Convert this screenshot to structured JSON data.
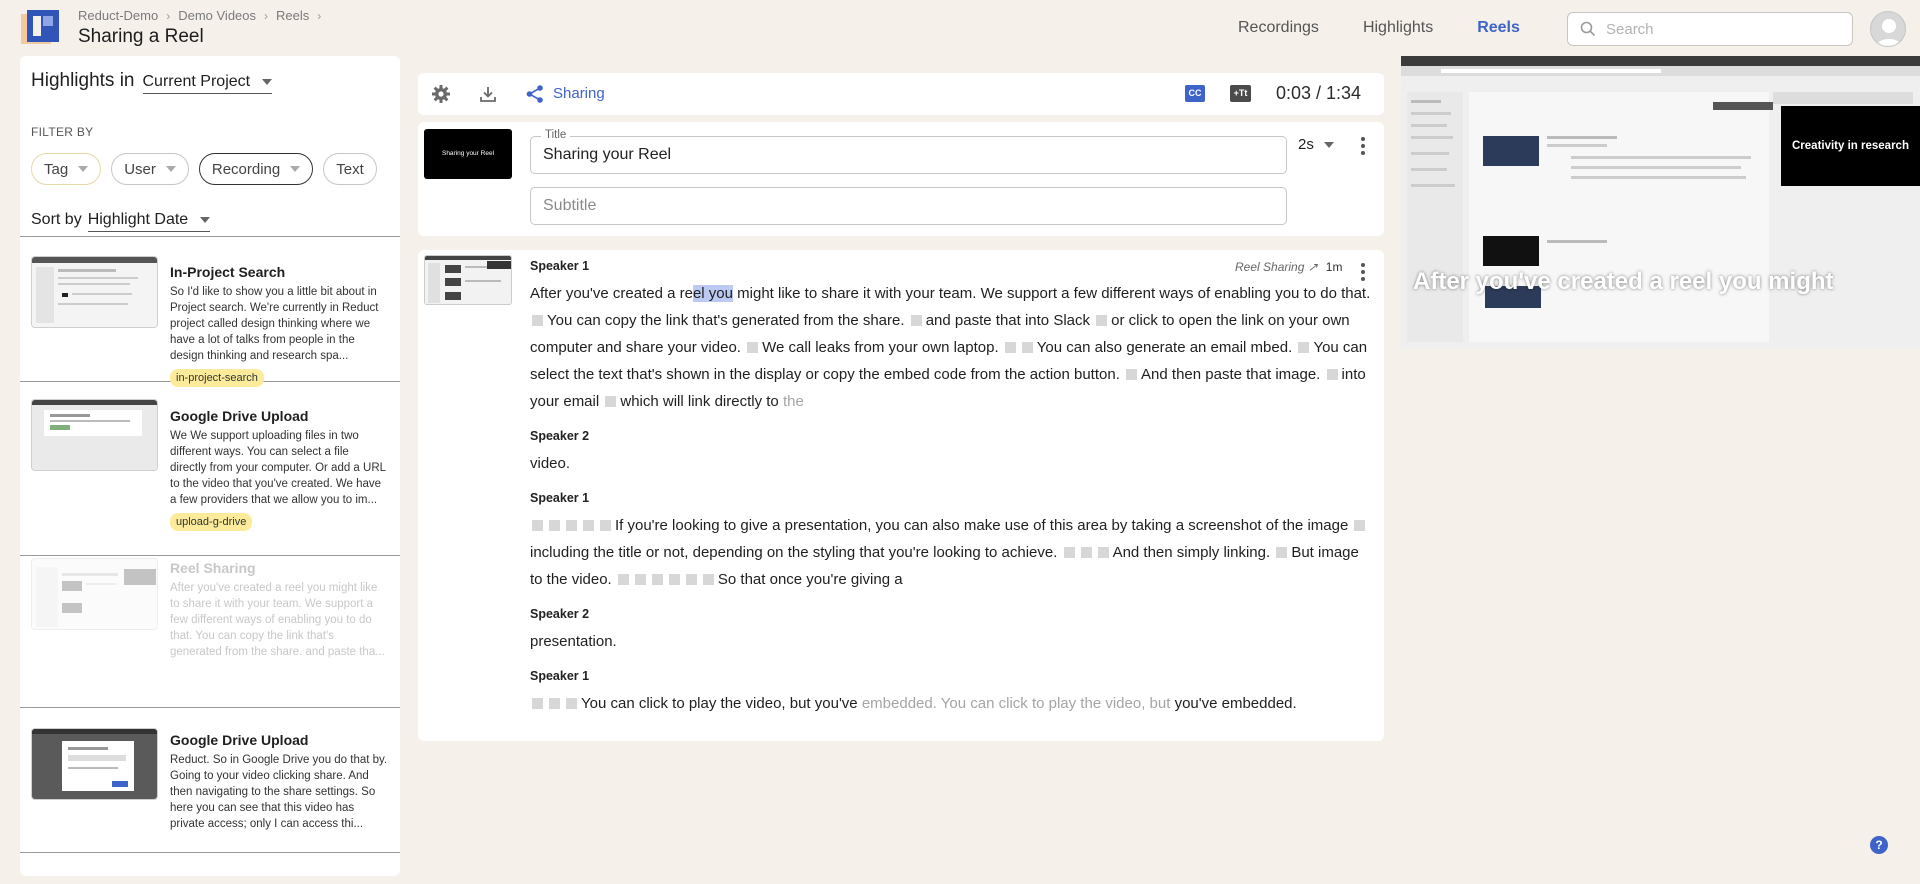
{
  "breadcrumb": [
    "Reduct-Demo",
    "Demo Videos",
    "Reels"
  ],
  "page_title": "Sharing a Reel",
  "nav": [
    {
      "label": "Recordings",
      "active": false
    },
    {
      "label": "Highlights",
      "active": false
    },
    {
      "label": "Reels",
      "active": true
    }
  ],
  "search": {
    "placeholder": "Search"
  },
  "highlights_panel": {
    "title": "Highlights in",
    "scope": "Current Project",
    "filter_by": "FILTER BY",
    "filters": [
      "Tag",
      "User",
      "Recording",
      "Text"
    ],
    "sort_label": "Sort by",
    "sort_value": "Highlight Date",
    "items": [
      {
        "title": "In-Project Search",
        "desc": "So I'd like to show you a little bit about in Project search. We're currently in Reduct project called design thinking where we have a lot of talks from people in the design thinking and research spa...",
        "tag": "in-project-search"
      },
      {
        "title": "Google Drive Upload",
        "desc": "We We support uploading files in two different ways. You can select a file directly from your computer. Or add a URL to the video that you've created. We have a few providers that we allow you to im...",
        "tag": "upload-g-drive"
      },
      {
        "title": "Reel Sharing",
        "desc": "After you've created a reel you might like to share it with your team. We support a few different ways of enabling you to do that. You can copy the link that's generated from the share. and paste tha...",
        "tag": ""
      },
      {
        "title": "Google Drive Upload",
        "desc": "Reduct. So in Google Drive you do that by. Going to your video clicking share. And then navigating to the share settings. So here you can see that this video has private access; only I can access thi...",
        "tag": ""
      }
    ]
  },
  "toolbar": {
    "sharing_label": "Sharing",
    "cc_label": "CC",
    "tt_label": "+Tt",
    "time": "0:03 / 1:34"
  },
  "title_card": {
    "thumb_text": "Sharing your Reel",
    "title_label": "Title",
    "title_value": "Sharing your Reel",
    "subtitle_placeholder": "Subtitle",
    "duration": "2s"
  },
  "transcript": {
    "source": "Reel Sharing",
    "length": "1m",
    "speakers": {
      "s1": "Speaker 1",
      "s2": "Speaker 2"
    },
    "p1": {
      "pre": "After you've created a re",
      "hl": "el you",
      "post": " might like to share it with your team. We support a few different ways of enabling you to do that.",
      "t2": "You can copy the link that's generated from the share.",
      "t3": "and paste that into Slack",
      "t4": "or click to open the link on your own computer and share your video.",
      "t5": "We call leaks from your own laptop.",
      "t6": "You can also generate an email mbed.",
      "t7": "You can select the text that's shown in the display or copy the embed code from the action button.",
      "t8": "And then paste that image.",
      "t9": "into your email",
      "t10": "which will link directly to",
      "t11": "the"
    },
    "p2": "video.",
    "p3": {
      "t1": "If you're looking to give a presentation, you can also make use of this area by taking a screenshot of the image",
      "t2": "including the title or not, depending on the styling that you're looking to achieve.",
      "t3": "And then simply linking.",
      "t4": "But image to the video.",
      "t5": "So that once you're giving a"
    },
    "p4": "presentation.",
    "p5": {
      "t1": "You can click to play the video, but you've",
      "t2": "embedded. You can click to play the video, but",
      "t3": "you've embedded."
    }
  },
  "video": {
    "caption": "After you've created a reel you might",
    "pip_text": "Creativity in research"
  }
}
